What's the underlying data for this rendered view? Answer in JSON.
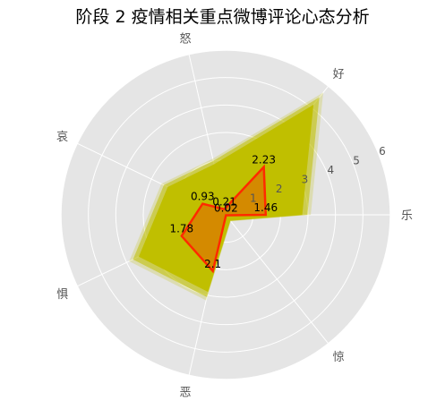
{
  "chart_data": {
    "type": "radar",
    "title": "阶段 2 疫情相关重点微博评论心态分析",
    "categories": [
      "乐",
      "好",
      "怒",
      "哀",
      "惧",
      "恶",
      "惊"
    ],
    "series": [
      {
        "values": [
          1.46,
          2.23,
          0.21,
          0.93,
          1.78,
          2.1,
          0.02
        ],
        "color": "#ff2a00"
      },
      {
        "values": [
          3.1,
          5.7,
          2.1,
          2.6,
          3.9,
          3.2,
          0.3
        ],
        "color": "#c0bf00"
      }
    ],
    "rlim": [
      0,
      6
    ],
    "r_ticks": [
      "0",
      "1",
      "2",
      "3",
      "4",
      "5",
      "6"
    ],
    "grid": true,
    "fill_color": "#d48a00",
    "background_color": "#e5e5e5"
  }
}
